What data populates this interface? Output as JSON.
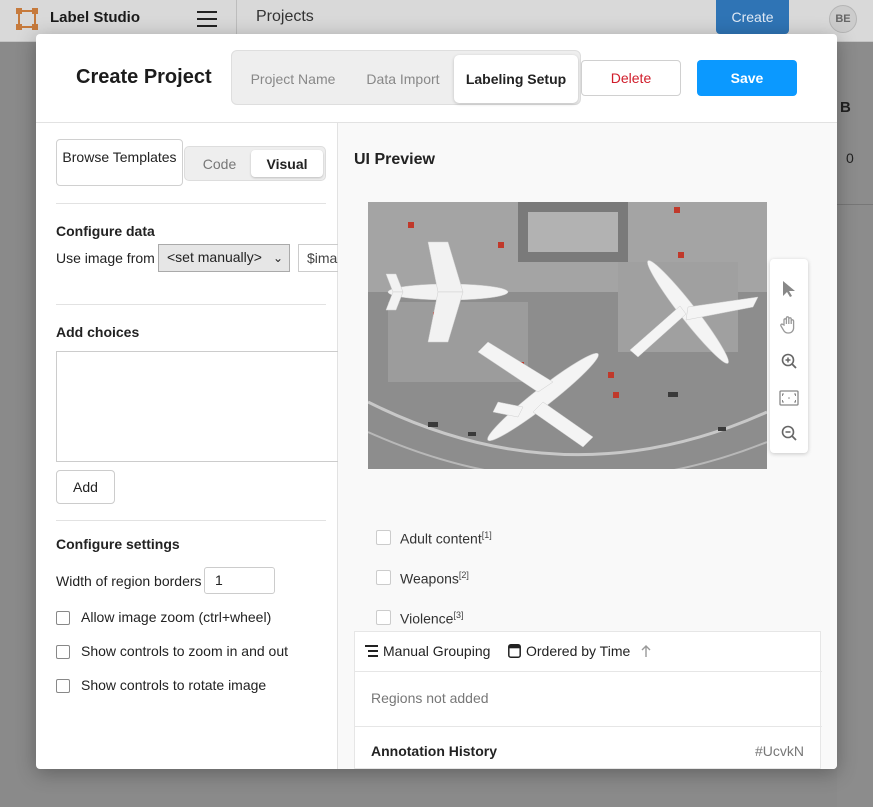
{
  "app": {
    "name": "Label Studio",
    "breadcrumb": "Projects",
    "create_label": "Create",
    "avatar_initials": "BE"
  },
  "background": {
    "column_letter": "B",
    "count": "0"
  },
  "modal": {
    "title": "Create Project",
    "steps": [
      {
        "label": "Project Name",
        "active": false
      },
      {
        "label": "Data Import",
        "active": false
      },
      {
        "label": "Labeling Setup",
        "active": true
      }
    ],
    "delete_label": "Delete",
    "save_label": "Save"
  },
  "config": {
    "browse_label": "Browse Templates",
    "mode_options": [
      "Code",
      "Visual"
    ],
    "mode_selected": "Visual",
    "configure_data_title": "Configure data",
    "use_image_from_label": "Use image from",
    "image_source_value": "<set manually>",
    "image_var_value": "$image",
    "add_choices_title": "Add choices",
    "add_label": "Add",
    "configure_settings_title": "Configure settings",
    "border_width_label": "Width of region borders",
    "border_width_value": "1",
    "settings": [
      {
        "label": "Allow image zoom (ctrl+wheel)",
        "checked": false
      },
      {
        "label": "Show controls to zoom in and out",
        "checked": false
      },
      {
        "label": "Show controls to rotate image",
        "checked": false
      }
    ]
  },
  "preview": {
    "title": "UI Preview",
    "tools": [
      "pointer-icon",
      "hand-icon",
      "zoom-in-icon",
      "fit-icon",
      "zoom-out-icon"
    ],
    "choices": [
      {
        "label": "Adult content",
        "hotkey": "[1]"
      },
      {
        "label": "Weapons",
        "hotkey": "[2]"
      },
      {
        "label": "Violence",
        "hotkey": "[3]"
      }
    ],
    "grouping_label": "Manual Grouping",
    "ordering_label": "Ordered by Time",
    "regions_empty": "Regions not added",
    "history_title": "Annotation History",
    "annotation_id": "#UcvkN"
  },
  "colors": {
    "save": "#0b99ff",
    "delete": "#d01c2a",
    "create": "#2f74b5",
    "logo": "#c67a3c"
  }
}
